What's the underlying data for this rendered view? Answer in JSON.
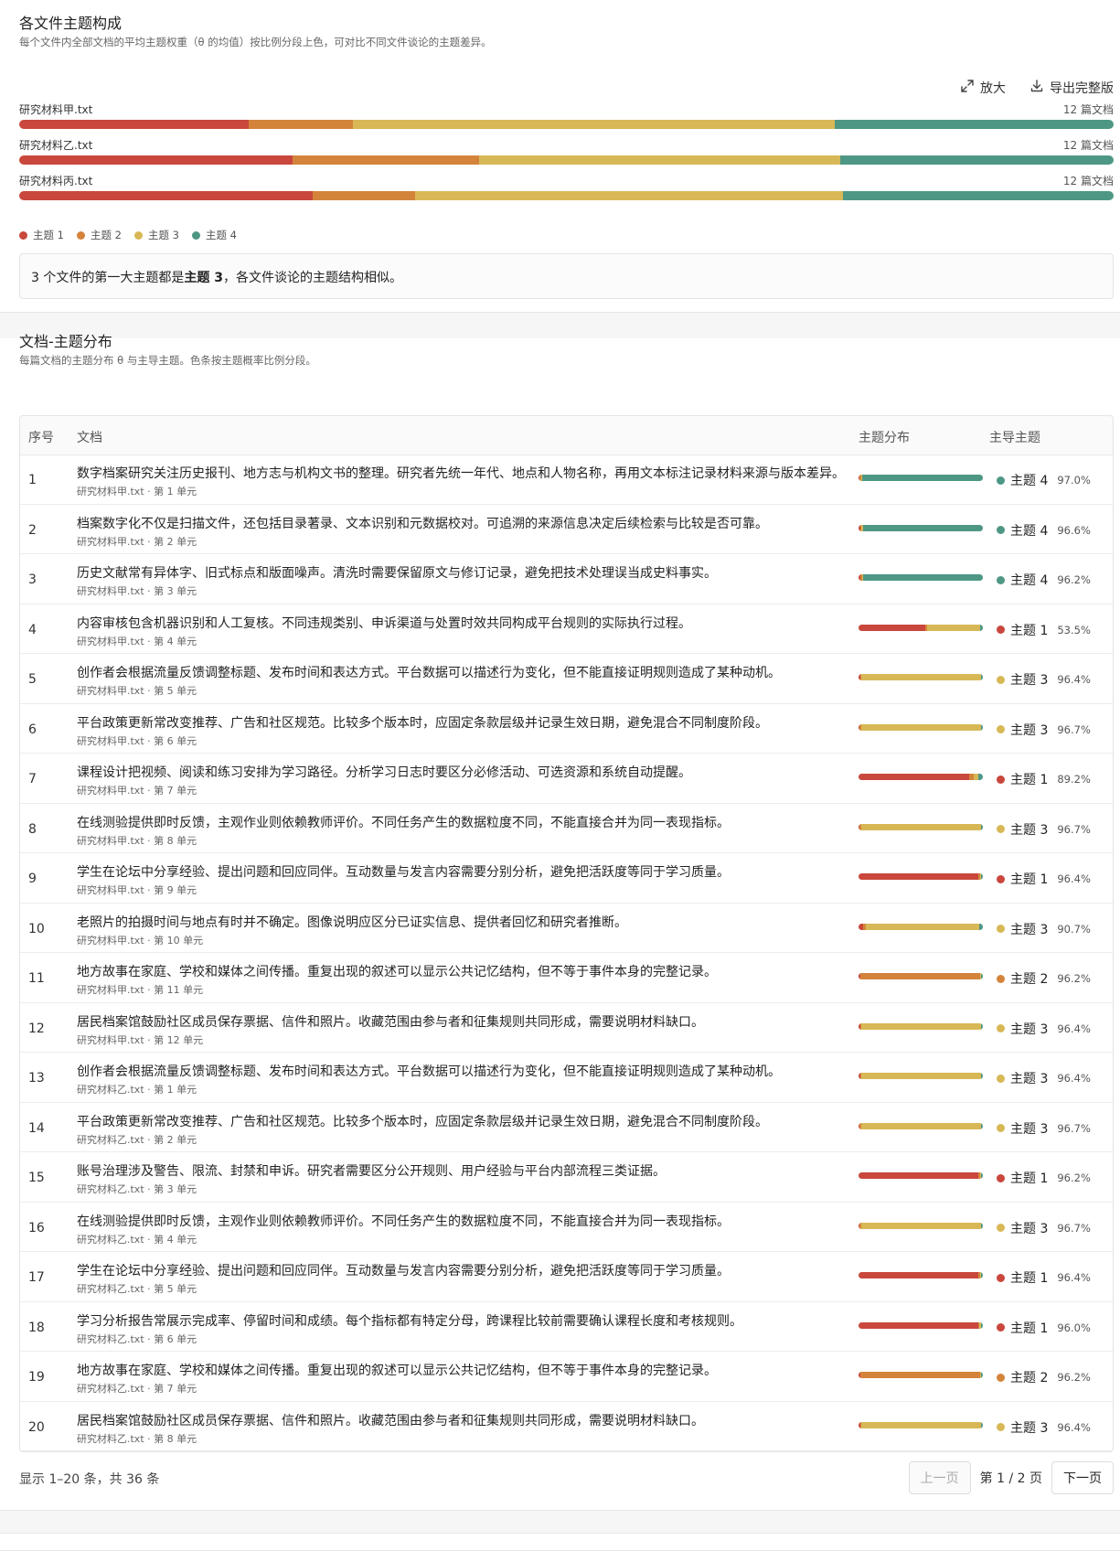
{
  "colors": {
    "topic1": "#c9473c",
    "topic2": "#d4843a",
    "topic3": "#d8b856",
    "topic4": "#4e9785"
  },
  "composition": {
    "title": "各文件主题构成",
    "subtitle": "每个文件内全部文档的平均主题权重（θ 的均值）按比例分段上色，可对比不同文件谈论的主题差异。",
    "tools": {
      "zoom_label": "放大",
      "export_label": "导出完整版"
    },
    "files": [
      {
        "name": "研究材料甲.txt",
        "count": "12 篇文档",
        "weights": [
          0.21,
          0.095,
          0.44,
          0.255
        ]
      },
      {
        "name": "研究材料乙.txt",
        "count": "12 篇文档",
        "weights": [
          0.25,
          0.17,
          0.33,
          0.25
        ]
      },
      {
        "name": "研究材料丙.txt",
        "count": "12 篇文档",
        "weights": [
          0.268,
          0.094,
          0.391,
          0.247
        ]
      }
    ],
    "legend": [
      "主题 1",
      "主题 2",
      "主题 3",
      "主题 4"
    ],
    "insight": {
      "prefix": "3 个文件的第一大主题都是",
      "topic": "主题 3",
      "suffix": "，各文件谈论的主题结构相似。"
    }
  },
  "distribution": {
    "title": "文档-主题分布",
    "subtitle": "每篇文档的主题分布 θ 与主导主题。色条按主题概率比例分段。",
    "headers": {
      "index": "序号",
      "doc": "文档",
      "dist": "主题分布",
      "dominant": "主导主题"
    },
    "rows": [
      {
        "index": "1",
        "text": "数字档案研究关注历史报刊、地方志与机构文书的整理。研究者先统一年代、地点和人物名称，再用文本标注记录材料来源与版本差异。",
        "source": "研究材料甲.txt · 第 1 单元",
        "theta": [
          0.01,
          0.01,
          0.01,
          0.97
        ],
        "dominant": "主题 4",
        "dominant_topic": 4,
        "pct": "97.0%"
      },
      {
        "index": "2",
        "text": "档案数字化不仅是扫描文件，还包括目录著录、文本识别和元数据校对。可追溯的来源信息决定后续检索与比较是否可靠。",
        "source": "研究材料甲.txt · 第 2 单元",
        "theta": [
          0.012,
          0.011,
          0.011,
          0.966
        ],
        "dominant": "主题 4",
        "dominant_topic": 4,
        "pct": "96.6%"
      },
      {
        "index": "3",
        "text": "历史文献常有异体字、旧式标点和版面噪声。清洗时需要保留原文与修订记录，避免把技术处理误当成史料事实。",
        "source": "研究材料甲.txt · 第 3 单元",
        "theta": [
          0.013,
          0.013,
          0.012,
          0.962
        ],
        "dominant": "主题 4",
        "dominant_topic": 4,
        "pct": "96.2%"
      },
      {
        "index": "4",
        "text": "内容审核包含机器识别和人工复核。不同违规类别、申诉渠道与处置时效共同构成平台规则的实际执行过程。",
        "source": "研究材料甲.txt · 第 4 单元",
        "theta": [
          0.535,
          0.02,
          0.425,
          0.02
        ],
        "dominant": "主题 1",
        "dominant_topic": 1,
        "pct": "53.5%"
      },
      {
        "index": "5",
        "text": "创作者会根据流量反馈调整标题、发布时间和表达方式。平台数据可以描述行为变化，但不能直接证明规则造成了某种动机。",
        "source": "研究材料甲.txt · 第 5 单元",
        "theta": [
          0.012,
          0.012,
          0.964,
          0.012
        ],
        "dominant": "主题 3",
        "dominant_topic": 3,
        "pct": "96.4%"
      },
      {
        "index": "6",
        "text": "平台政策更新常改变推荐、广告和社区规范。比较多个版本时，应固定条款层级并记录生效日期，避免混合不同制度阶段。",
        "source": "研究材料甲.txt · 第 6 单元",
        "theta": [
          0.011,
          0.011,
          0.967,
          0.011
        ],
        "dominant": "主题 3",
        "dominant_topic": 3,
        "pct": "96.7%"
      },
      {
        "index": "7",
        "text": "课程设计把视频、阅读和练习安排为学习路径。分析学习日志时要区分必修活动、可选资源和系统自动提醒。",
        "source": "研究材料甲.txt · 第 7 单元",
        "theta": [
          0.892,
          0.036,
          0.036,
          0.036
        ],
        "dominant": "主题 1",
        "dominant_topic": 1,
        "pct": "89.2%"
      },
      {
        "index": "8",
        "text": "在线测验提供即时反馈，主观作业则依赖教师评价。不同任务产生的数据粒度不同，不能直接合并为同一表现指标。",
        "source": "研究材料甲.txt · 第 8 单元",
        "theta": [
          0.011,
          0.011,
          0.967,
          0.011
        ],
        "dominant": "主题 3",
        "dominant_topic": 3,
        "pct": "96.7%"
      },
      {
        "index": "9",
        "text": "学生在论坛中分享经验、提出问题和回应同伴。互动数量与发言内容需要分别分析，避免把活跃度等同于学习质量。",
        "source": "研究材料甲.txt · 第 9 单元",
        "theta": [
          0.964,
          0.012,
          0.012,
          0.012
        ],
        "dominant": "主题 1",
        "dominant_topic": 1,
        "pct": "96.4%"
      },
      {
        "index": "10",
        "text": "老照片的拍摄时间与地点有时并不确定。图像说明应区分已证实信息、提供者回忆和研究者推断。",
        "source": "研究材料甲.txt · 第 10 单元",
        "theta": [
          0.04,
          0.02,
          0.907,
          0.033
        ],
        "dominant": "主题 3",
        "dominant_topic": 3,
        "pct": "90.7%"
      },
      {
        "index": "11",
        "text": "地方故事在家庭、学校和媒体之间传播。重复出现的叙述可以显示公共记忆结构，但不等于事件本身的完整记录。",
        "source": "研究材料甲.txt · 第 11 单元",
        "theta": [
          0.013,
          0.962,
          0.013,
          0.012
        ],
        "dominant": "主题 2",
        "dominant_topic": 2,
        "pct": "96.2%"
      },
      {
        "index": "12",
        "text": "居民档案馆鼓励社区成员保存票据、信件和照片。收藏范围由参与者和征集规则共同形成，需要说明材料缺口。",
        "source": "研究材料甲.txt · 第 12 单元",
        "theta": [
          0.012,
          0.012,
          0.964,
          0.012
        ],
        "dominant": "主题 3",
        "dominant_topic": 3,
        "pct": "96.4%"
      },
      {
        "index": "13",
        "text": "创作者会根据流量反馈调整标题、发布时间和表达方式。平台数据可以描述行为变化，但不能直接证明规则造成了某种动机。",
        "source": "研究材料乙.txt · 第 1 单元",
        "theta": [
          0.012,
          0.012,
          0.964,
          0.012
        ],
        "dominant": "主题 3",
        "dominant_topic": 3,
        "pct": "96.4%"
      },
      {
        "index": "14",
        "text": "平台政策更新常改变推荐、广告和社区规范。比较多个版本时，应固定条款层级并记录生效日期，避免混合不同制度阶段。",
        "source": "研究材料乙.txt · 第 2 单元",
        "theta": [
          0.011,
          0.011,
          0.967,
          0.011
        ],
        "dominant": "主题 3",
        "dominant_topic": 3,
        "pct": "96.7%"
      },
      {
        "index": "15",
        "text": "账号治理涉及警告、限流、封禁和申诉。研究者需要区分公开规则、用户经验与平台内部流程三类证据。",
        "source": "研究材料乙.txt · 第 3 单元",
        "theta": [
          0.962,
          0.013,
          0.013,
          0.012
        ],
        "dominant": "主题 1",
        "dominant_topic": 1,
        "pct": "96.2%"
      },
      {
        "index": "16",
        "text": "在线测验提供即时反馈，主观作业则依赖教师评价。不同任务产生的数据粒度不同，不能直接合并为同一表现指标。",
        "source": "研究材料乙.txt · 第 4 单元",
        "theta": [
          0.011,
          0.011,
          0.967,
          0.011
        ],
        "dominant": "主题 3",
        "dominant_topic": 3,
        "pct": "96.7%"
      },
      {
        "index": "17",
        "text": "学生在论坛中分享经验、提出问题和回应同伴。互动数量与发言内容需要分别分析，避免把活跃度等同于学习质量。",
        "source": "研究材料乙.txt · 第 5 单元",
        "theta": [
          0.964,
          0.012,
          0.012,
          0.012
        ],
        "dominant": "主题 1",
        "dominant_topic": 1,
        "pct": "96.4%"
      },
      {
        "index": "18",
        "text": "学习分析报告常展示完成率、停留时间和成绩。每个指标都有特定分母，跨课程比较前需要确认课程长度和考核规则。",
        "source": "研究材料乙.txt · 第 6 单元",
        "theta": [
          0.96,
          0.013,
          0.013,
          0.014
        ],
        "dominant": "主题 1",
        "dominant_topic": 1,
        "pct": "96.0%"
      },
      {
        "index": "19",
        "text": "地方故事在家庭、学校和媒体之间传播。重复出现的叙述可以显示公共记忆结构，但不等于事件本身的完整记录。",
        "source": "研究材料乙.txt · 第 7 单元",
        "theta": [
          0.013,
          0.962,
          0.013,
          0.012
        ],
        "dominant": "主题 2",
        "dominant_topic": 2,
        "pct": "96.2%"
      },
      {
        "index": "20",
        "text": "居民档案馆鼓励社区成员保存票据、信件和照片。收藏范围由参与者和征集规则共同形成，需要说明材料缺口。",
        "source": "研究材料乙.txt · 第 8 单元",
        "theta": [
          0.012,
          0.012,
          0.964,
          0.012
        ],
        "dominant": "主题 3",
        "dominant_topic": 3,
        "pct": "96.4%"
      }
    ],
    "pagination": {
      "info": "显示 1–20 条，共 36 条",
      "prev": "上一页",
      "page": "第 1 / 2 页",
      "next": "下一页"
    }
  }
}
